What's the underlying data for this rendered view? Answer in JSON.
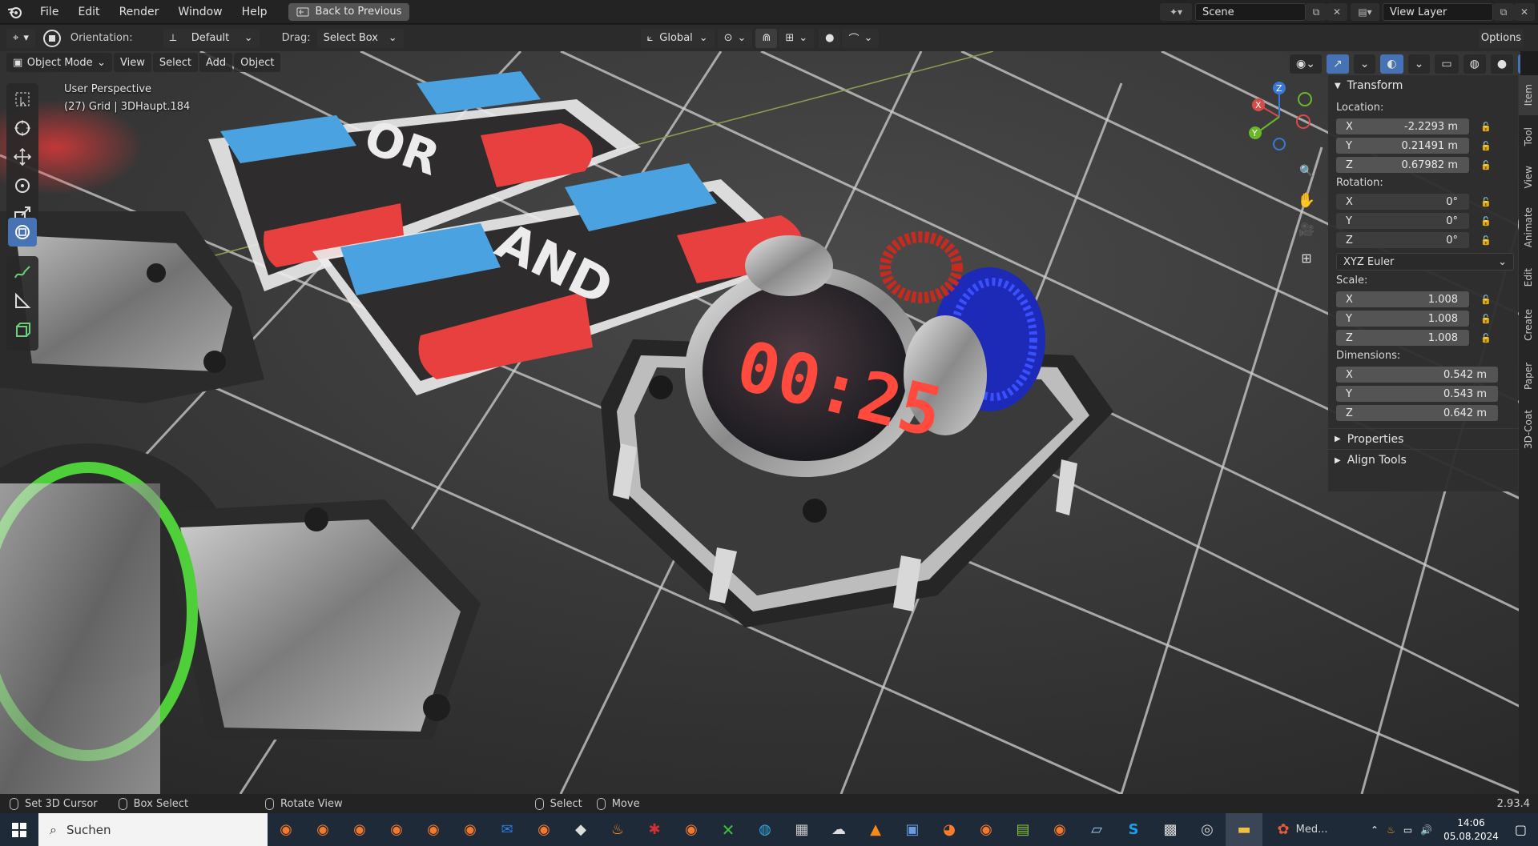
{
  "menu": {
    "items": [
      "File",
      "Edit",
      "Render",
      "Window",
      "Help"
    ],
    "back_button": "Back to Previous"
  },
  "scene": {
    "label": "Scene",
    "view_layer": "View Layer"
  },
  "toolbar": {
    "orientation_label": "Orientation:",
    "orientation_value": "Default",
    "drag_label": "Drag:",
    "drag_value": "Select Box",
    "transform_space": "Global",
    "options_label": "Options"
  },
  "viewport": {
    "mode": "Object Mode",
    "menus": [
      "View",
      "Select",
      "Add",
      "Object"
    ],
    "perspective": "User Perspective",
    "info": "(27) Grid | 3DHaupt.184",
    "board_labels": [
      "OR",
      "AND"
    ],
    "display_time": "00:25",
    "gizmo_axes": [
      "X",
      "Y",
      "Z"
    ]
  },
  "npanel": {
    "transform_header": "Transform",
    "location_label": "Location:",
    "location": [
      {
        "axis": "X",
        "value": "-2.2293 m"
      },
      {
        "axis": "Y",
        "value": "0.21491 m"
      },
      {
        "axis": "Z",
        "value": "0.67982 m"
      }
    ],
    "rotation_label": "Rotation:",
    "rotation": [
      {
        "axis": "X",
        "value": "0°"
      },
      {
        "axis": "Y",
        "value": "0°"
      },
      {
        "axis": "Z",
        "value": "0°"
      }
    ],
    "rotation_mode": "XYZ Euler",
    "scale_label": "Scale:",
    "scale": [
      {
        "axis": "X",
        "value": "1.008"
      },
      {
        "axis": "Y",
        "value": "1.008"
      },
      {
        "axis": "Z",
        "value": "1.008"
      }
    ],
    "dimensions_label": "Dimensions:",
    "dimensions": [
      {
        "axis": "X",
        "value": "0.542 m"
      },
      {
        "axis": "Y",
        "value": "0.543 m"
      },
      {
        "axis": "Z",
        "value": "0.642 m"
      }
    ],
    "properties_header": "Properties",
    "align_tools_header": "Align Tools"
  },
  "side_tabs": [
    "Item",
    "Tool",
    "View",
    "Animate",
    "Edit",
    "Create",
    "Paper",
    "3D-Coat"
  ],
  "statusbar": {
    "set_cursor": "Set 3D Cursor",
    "box_select": "Box Select",
    "rotate_view": "Rotate View",
    "select": "Select",
    "move": "Move",
    "version": "2.93.4"
  },
  "taskbar": {
    "search_placeholder": "Suchen",
    "active_app_label": "Med...",
    "time": "14:06",
    "date": "05.08.2024"
  },
  "colors": {
    "accent": "#4772b3",
    "board_red": "#e8403f",
    "board_blue": "#4aa3e0",
    "display_red": "#ff4a3d",
    "grid_line": "#cfcfcf"
  }
}
